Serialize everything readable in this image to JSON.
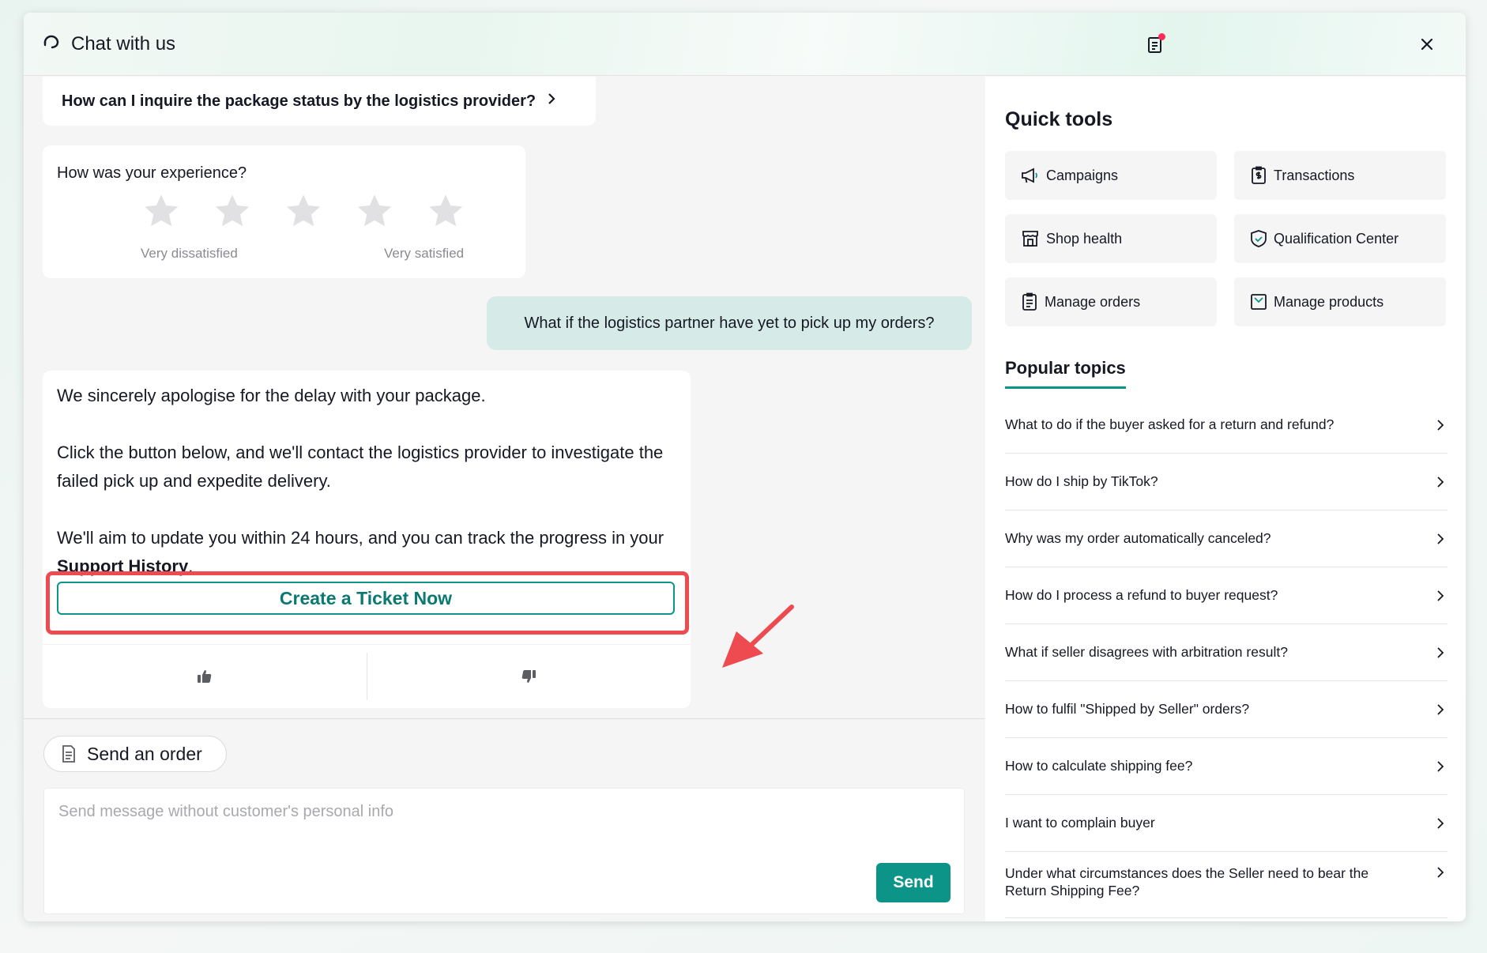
{
  "header": {
    "title": "Chat with us"
  },
  "chat": {
    "faq_link": "How can I inquire the package status by the logistics provider?",
    "rating": {
      "question": "How was your experience?",
      "low_label": "Very dissatisfied",
      "high_label": "Very satisfied",
      "stars": 5
    },
    "user_message": "What if the logistics partner have yet to pick up my orders?",
    "bot": {
      "p1": "We sincerely apologise for the delay with your package.",
      "p2": "Click the button below, and we'll contact the logistics provider to investigate the failed pick up and expedite delivery.",
      "p3_prefix": "We'll aim to update you within 24 hours, and you can track the progress in your ",
      "p3_bold": "Support History",
      "p3_suffix": ".",
      "button": "Create a Ticket Now"
    }
  },
  "composer": {
    "send_order": "Send an order",
    "placeholder": "Send message without customer's personal info",
    "send": "Send"
  },
  "side": {
    "quick_tools_title": "Quick tools",
    "tools": [
      {
        "label": "Campaigns",
        "icon": "megaphone-icon"
      },
      {
        "label": "Transactions",
        "icon": "transactions-icon"
      },
      {
        "label": "Shop health",
        "icon": "shop-icon"
      },
      {
        "label": "Qualification Center",
        "icon": "shield-icon"
      },
      {
        "label": "Manage orders",
        "icon": "clipboard-icon"
      },
      {
        "label": "Manage products",
        "icon": "box-icon"
      }
    ],
    "popular_topics_title": "Popular topics",
    "topics": [
      "What to do if the buyer asked for a return and refund?",
      "How do I ship by TikTok?",
      "Why was my order automatically canceled?",
      "How do I process a refund to buyer request?",
      "What if seller disagrees with arbitration result?",
      "How to fulfil \"Shipped by Seller\" orders?",
      "How to calculate shipping fee?",
      "I want to complain buyer",
      "Under what circumstances does the Seller need to bear the Return Shipping Fee?"
    ]
  },
  "colors": {
    "accent": "#0d9488",
    "highlight": "#ee4b50",
    "user_bubble": "#d6ebe7"
  }
}
